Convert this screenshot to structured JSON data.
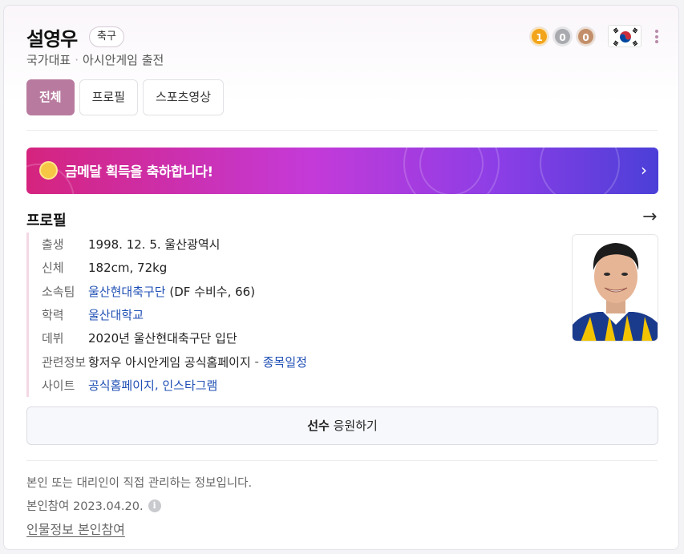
{
  "profile": {
    "name": "설영우",
    "sport": "축구",
    "subtitle_role": "국가대표",
    "subtitle_event": "아시안게임 출전"
  },
  "medals": {
    "gold": "1",
    "silver": "0",
    "bronze": "0"
  },
  "flag_icon": "korea-flag-icon",
  "tabs": [
    "전체",
    "프로필",
    "스포츠영상"
  ],
  "banner": {
    "text": "금메달 획득을 축하합니다!",
    "colors": [
      "#d5247e",
      "#c43ad8",
      "#4b3fd8"
    ]
  },
  "section": {
    "title": "프로필"
  },
  "info": {
    "birth": {
      "label": "출생",
      "value": "1998. 12. 5. 울산광역시"
    },
    "body": {
      "label": "신체",
      "value": "182cm, 72kg"
    },
    "team": {
      "label": "소속팀",
      "link": "울산현대축구단",
      "extra": "(DF 수비수, 66)"
    },
    "education": {
      "label": "학력",
      "link": "울산대학교"
    },
    "debut": {
      "label": "데뷔",
      "value": "2020년 울산현대축구단 입단"
    },
    "related": {
      "label": "관련정보",
      "value": "항저우 아시안게임 공식홈페이지",
      "sep": "-",
      "link": "종목일정"
    },
    "site": {
      "label": "사이트",
      "link1": "공식홈페이지",
      "link2": "인스타그램"
    }
  },
  "cheer": {
    "bold": "선수",
    "rest": "응원하기"
  },
  "footer": {
    "managed": "본인 또는 대리인이 직접 관리하는 정보입니다.",
    "participation": "본인참여 2023.04.20.",
    "link": "인물정보 본인참여"
  },
  "accent_color": "#b87b9f",
  "link_color": "#1f4fb4"
}
